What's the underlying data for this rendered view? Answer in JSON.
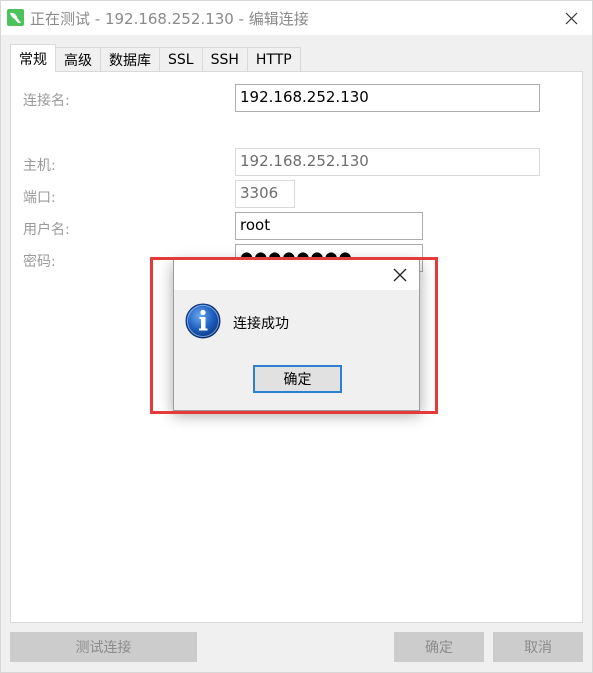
{
  "window": {
    "title": "正在测试 - 192.168.252.130 - 编辑连接"
  },
  "tabs": [
    {
      "label": "常规",
      "active": true
    },
    {
      "label": "高级",
      "active": false
    },
    {
      "label": "数据库",
      "active": false
    },
    {
      "label": "SSL",
      "active": false
    },
    {
      "label": "SSH",
      "active": false
    },
    {
      "label": "HTTP",
      "active": false
    }
  ],
  "form": {
    "connection_name_label": "连接名:",
    "connection_name_value": "192.168.252.130",
    "host_label": "主机:",
    "host_value": "192.168.252.130",
    "port_label": "端口:",
    "port_value": "3306",
    "username_label": "用户名:",
    "username_value": "root",
    "password_label": "密码:",
    "password_value": "●●●●●●●●"
  },
  "footer": {
    "test_button": "测试连接",
    "ok_button": "确定",
    "cancel_button": "取消"
  },
  "dialog": {
    "message": "连接成功",
    "ok_button": "确定",
    "icon": "info-icon"
  },
  "colors": {
    "highlight": "#e53a3a",
    "app_icon": "#4cc35a",
    "focus": "#2d7fd1"
  }
}
